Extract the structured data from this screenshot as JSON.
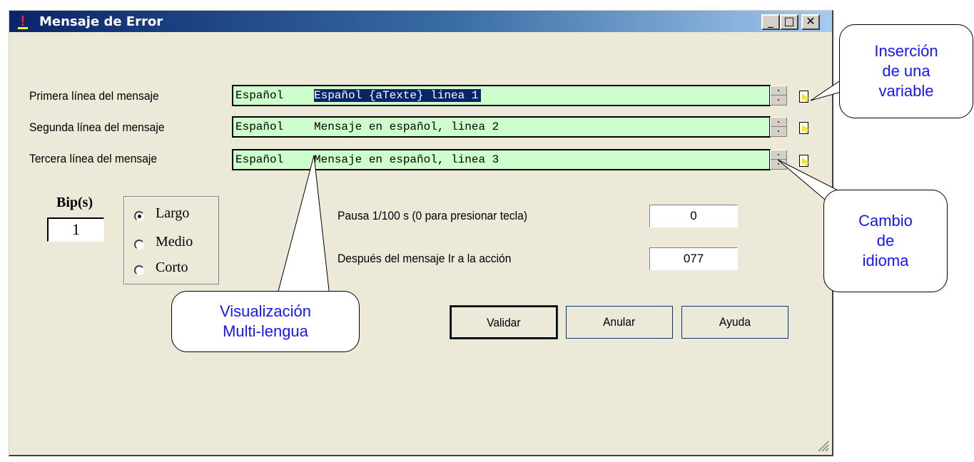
{
  "window": {
    "title": "Mensaje de Error",
    "title_icon": "exclamation-icon",
    "controls": {
      "minimize": "_",
      "maximize": "□",
      "close": "✕"
    }
  },
  "message_lines": [
    {
      "label": "Primera línea del mensaje",
      "language": "Español",
      "text": "Español {aTexte} linea 1",
      "selected": true
    },
    {
      "label": "Segunda línea del mensaje",
      "language": "Español",
      "text": "Mensaje en español, linea 2",
      "selected": false
    },
    {
      "label": "Tercera línea del mensaje",
      "language": "Español",
      "text": "Mensaje en español, linea 3",
      "selected": false
    }
  ],
  "bip": {
    "label": "Bip(s)",
    "value": "1",
    "options": [
      "Largo",
      "Medio",
      "Corto"
    ],
    "selected": "Largo"
  },
  "pause": {
    "label": "Pausa 1/100 s (0 para presionar tecla)",
    "value": "0"
  },
  "after": {
    "label": "Después del mensaje Ir a la acción",
    "value": "077"
  },
  "buttons": {
    "validate": "Validar",
    "cancel": "Anular",
    "help": "Ayuda"
  },
  "callouts": {
    "variable": [
      "Inserción",
      "de una",
      "variable"
    ],
    "language": [
      "Cambio",
      "de",
      "idioma"
    ],
    "multilang": [
      "Visualización",
      "Multi-lengua"
    ]
  },
  "colors": {
    "field_bg": "#ccffcc",
    "selection": "#0a246a",
    "callout_text": "#1515ff"
  }
}
